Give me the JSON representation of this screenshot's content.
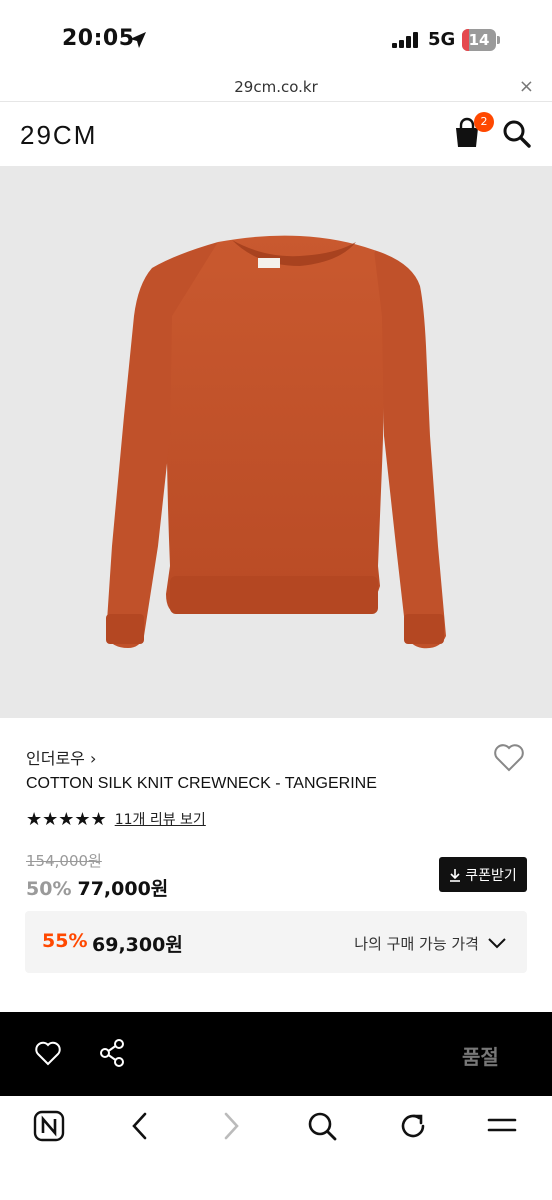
{
  "status": {
    "time": "20:05",
    "network": "5G",
    "battery": "14"
  },
  "browser": {
    "url": "29cm.co.kr",
    "close_label": "×"
  },
  "header": {
    "logo": "29CM",
    "cart_count": "2"
  },
  "product": {
    "brand": "인더로우 ›",
    "name": "COTTON SILK KNIT CREWNECK - TANGERINE",
    "stars": "★★★★★",
    "review_link": "11개 리뷰 보기",
    "original_price": "154,000원",
    "discount_pct": "50%",
    "sale_price": "77,000원",
    "coupon_button": "쿠폰받기",
    "best_pct": "55%",
    "best_price": "69,300원",
    "best_label": "나의 구매 가능 가격",
    "image_color": "#c2542e"
  },
  "action_bar": {
    "status": "품절"
  },
  "colors": {
    "accent": "#ff4800",
    "muted": "#9a9a9a"
  }
}
